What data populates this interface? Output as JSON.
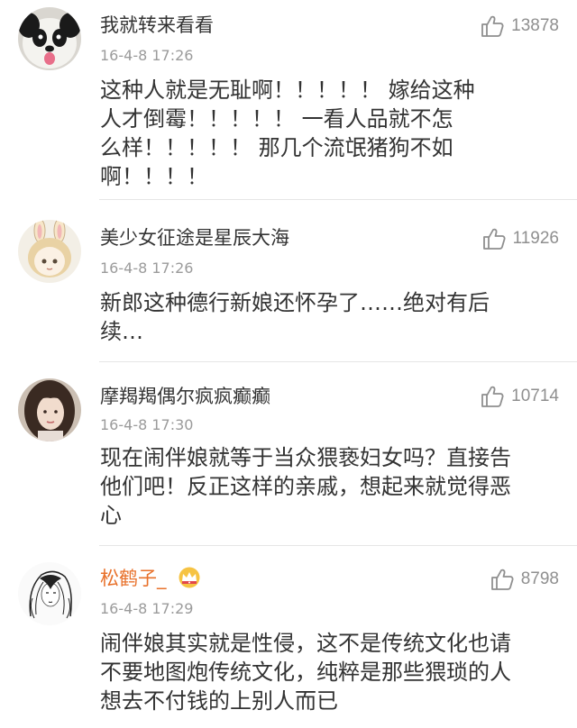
{
  "comments": [
    {
      "username": "我就转来看看",
      "time": "16-4-8 17:26",
      "likes": "13878",
      "text": "这种人就是无耻啊！！！！！ 嫁给这种\n人才倒霉！！！！！ 一看人品就不怎\n么样！！！！！ 那几个流氓猪狗不如\n啊！！！！",
      "avatar_icon": "panda-avatar"
    },
    {
      "username": "美少女征途是星辰大海",
      "time": "16-4-8 17:26",
      "likes": "11926",
      "text": "新郎这种德行新娘还怀孕了……绝对有后\n续…",
      "avatar_icon": "bunny-girl-avatar"
    },
    {
      "username": "摩羯羯偶尔疯疯癫癫",
      "time": "16-4-8 17:30",
      "likes": "10714",
      "text": "现在闹伴娘就等于当众猥亵妇女吗？直接告\n他们吧！反正这样的亲戚，想起来就觉得恶\n心",
      "avatar_icon": "girl-photo-avatar"
    },
    {
      "username": "松鹤子_",
      "time": "16-4-8 17:29",
      "likes": "8798",
      "text": "闹伴娘其实就是性侵，这不是传统文化也请\n不要地图炮传统文化，纯粹是那些猥琐的人\n想去不付钱的上别人而已",
      "avatar_icon": "sketch-woman-avatar",
      "badge_icon": "crown-icon",
      "name_color": "#e8712b"
    }
  ]
}
